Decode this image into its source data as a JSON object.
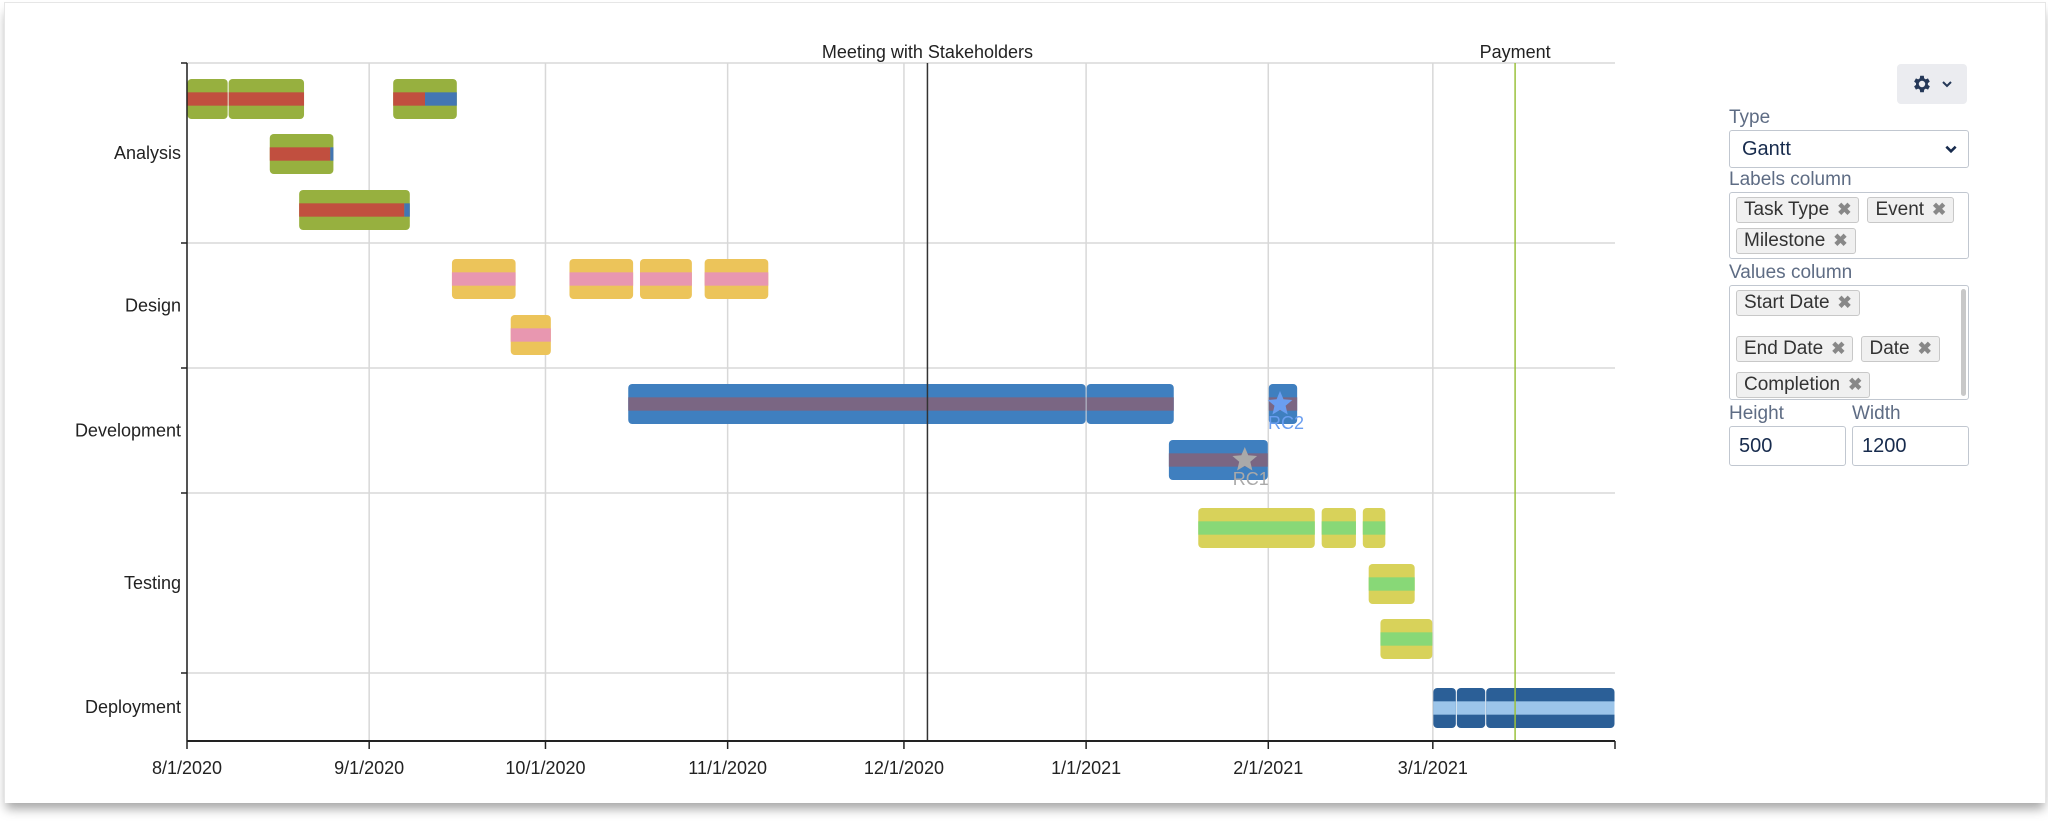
{
  "chart_data": {
    "type": "gantt",
    "title": "",
    "x_domain": [
      "2020-08-01",
      "2021-04-01"
    ],
    "x_ticks": [
      {
        "date": "2020-08-01",
        "label": "8/1/2020"
      },
      {
        "date": "2020-09-01",
        "label": "9/1/2020"
      },
      {
        "date": "2020-10-01",
        "label": "10/1/2020"
      },
      {
        "date": "2020-11-01",
        "label": "11/1/2020"
      },
      {
        "date": "2020-12-01",
        "label": "12/1/2020"
      },
      {
        "date": "2021-01-01",
        "label": "1/1/2021"
      },
      {
        "date": "2021-02-01",
        "label": "2/1/2021"
      },
      {
        "date": "2021-03-01",
        "label": "3/1/2021"
      }
    ],
    "grid": true,
    "categories": [
      {
        "name": "Analysis",
        "lanes": 3,
        "color": "#97b03f",
        "progress_color": "#c14f3f",
        "remaining_color": "#4376b3"
      },
      {
        "name": "Design",
        "lanes": 2,
        "color": "#ecc45a",
        "progress_color": "#e897b0",
        "remaining_color": "#ecc45a"
      },
      {
        "name": "Development",
        "lanes": 2,
        "color": "#3f7fbf",
        "progress_color": "#7a6683",
        "remaining_color": "#3f7fbf"
      },
      {
        "name": "Testing",
        "lanes": 3,
        "color": "#d8d25a",
        "progress_color": "#88d877",
        "remaining_color": "#d8d25a"
      },
      {
        "name": "Deployment",
        "lanes": 1,
        "color": "#2b5f97",
        "progress_color": "#9cc5ea",
        "remaining_color": "#2b5f97"
      }
    ],
    "tasks": [
      {
        "category": "Analysis",
        "lane": 0,
        "start": "2020-08-01",
        "end": "2020-08-08",
        "completion": 1.0
      },
      {
        "category": "Analysis",
        "lane": 0,
        "start": "2020-08-08",
        "end": "2020-08-21",
        "completion": 1.0
      },
      {
        "category": "Analysis",
        "lane": 0,
        "start": "2020-09-05",
        "end": "2020-09-16",
        "completion": 0.5
      },
      {
        "category": "Analysis",
        "lane": 1,
        "start": "2020-08-15",
        "end": "2020-08-26",
        "completion": 0.95
      },
      {
        "category": "Analysis",
        "lane": 2,
        "start": "2020-08-20",
        "end": "2020-09-08",
        "completion": 0.95
      },
      {
        "category": "Design",
        "lane": 0,
        "start": "2020-09-15",
        "end": "2020-09-26",
        "completion": 1.0
      },
      {
        "category": "Design",
        "lane": 0,
        "start": "2020-10-05",
        "end": "2020-10-16",
        "completion": 1.0
      },
      {
        "category": "Design",
        "lane": 0,
        "start": "2020-10-17",
        "end": "2020-10-26",
        "completion": 1.0
      },
      {
        "category": "Design",
        "lane": 0,
        "start": "2020-10-28",
        "end": "2020-11-08",
        "completion": 1.0
      },
      {
        "category": "Design",
        "lane": 1,
        "start": "2020-09-25",
        "end": "2020-10-02",
        "completion": 1.0
      },
      {
        "category": "Development",
        "lane": 0,
        "start": "2020-10-15",
        "end": "2021-01-01",
        "completion": 1.0
      },
      {
        "category": "Development",
        "lane": 0,
        "start": "2021-01-01",
        "end": "2021-01-16",
        "completion": 1.0
      },
      {
        "category": "Development",
        "lane": 0,
        "start": "2021-02-01",
        "end": "2021-02-06",
        "completion": 1.0
      },
      {
        "category": "Development",
        "lane": 1,
        "start": "2021-01-15",
        "end": "2021-02-01",
        "completion": 1.0
      },
      {
        "category": "Testing",
        "lane": 0,
        "start": "2021-01-20",
        "end": "2021-02-09",
        "completion": 1.0
      },
      {
        "category": "Testing",
        "lane": 0,
        "start": "2021-02-10",
        "end": "2021-02-16",
        "completion": 1.0
      },
      {
        "category": "Testing",
        "lane": 0,
        "start": "2021-02-17",
        "end": "2021-02-21",
        "completion": 1.0
      },
      {
        "category": "Testing",
        "lane": 1,
        "start": "2021-02-18",
        "end": "2021-02-26",
        "completion": 1.0
      },
      {
        "category": "Testing",
        "lane": 2,
        "start": "2021-02-20",
        "end": "2021-03-01",
        "completion": 1.0
      },
      {
        "category": "Deployment",
        "lane": 0,
        "start": "2021-03-01",
        "end": "2021-03-05",
        "completion": 1.0
      },
      {
        "category": "Deployment",
        "lane": 0,
        "start": "2021-03-05",
        "end": "2021-03-10",
        "completion": 1.0
      },
      {
        "category": "Deployment",
        "lane": 0,
        "start": "2021-03-10",
        "end": "2021-04-01",
        "completion": 1.0
      }
    ],
    "milestones": [
      {
        "label": "RC1",
        "category": "Development",
        "lane": 1,
        "date": "2021-01-28",
        "color": "#a9a9a9"
      },
      {
        "label": "RC2",
        "category": "Development",
        "lane": 0,
        "date": "2021-02-03",
        "color": "#6a9ef0"
      }
    ],
    "events": [
      {
        "label": "Meeting with Stakeholders",
        "date": "2020-12-05",
        "color": "#333333"
      },
      {
        "label": "Payment",
        "date": "2021-03-15",
        "color": "#9bc23c"
      }
    ]
  },
  "panel": {
    "settings_icon": "gear-icon",
    "type_label": "Type",
    "type_value": "Gantt",
    "labels_column_label": "Labels column",
    "labels_column_tags": [
      "Task Type",
      "Event",
      "Milestone"
    ],
    "values_column_label": "Values column",
    "values_column_tags": [
      "Start Date",
      "End Date",
      "Date",
      "Completion"
    ],
    "height_label": "Height",
    "height_value": "500",
    "width_label": "Width",
    "width_value": "1200"
  }
}
